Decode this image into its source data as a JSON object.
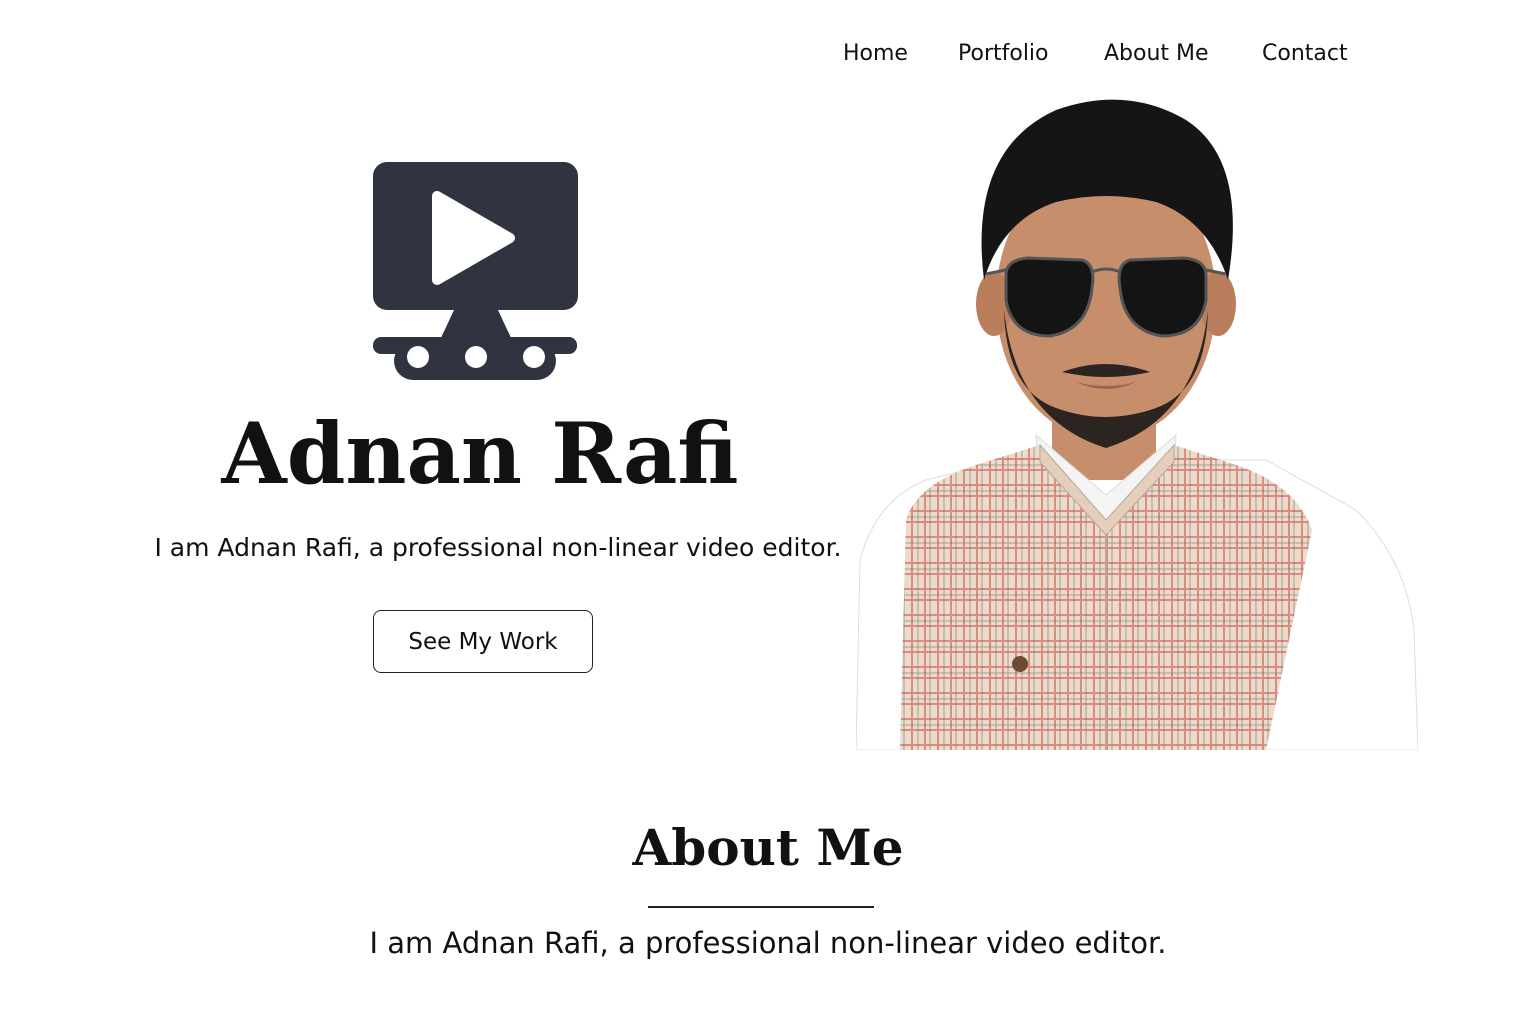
{
  "nav": {
    "items": [
      {
        "label": "Home"
      },
      {
        "label": "Portfolio"
      },
      {
        "label": "About Me"
      },
      {
        "label": "Contact"
      }
    ]
  },
  "hero": {
    "logo_icon": "video-player-icon",
    "name": "Adnan Rafi",
    "description": "I am Adnan Rafi, a professional non-linear video editor.",
    "cta_label": "See My Work"
  },
  "about": {
    "title": "About Me",
    "text": "I am Adnan Rafi, a professional non-linear video editor."
  },
  "colors": {
    "logo": "#2f3440",
    "text": "#111111",
    "background": "#ffffff"
  }
}
